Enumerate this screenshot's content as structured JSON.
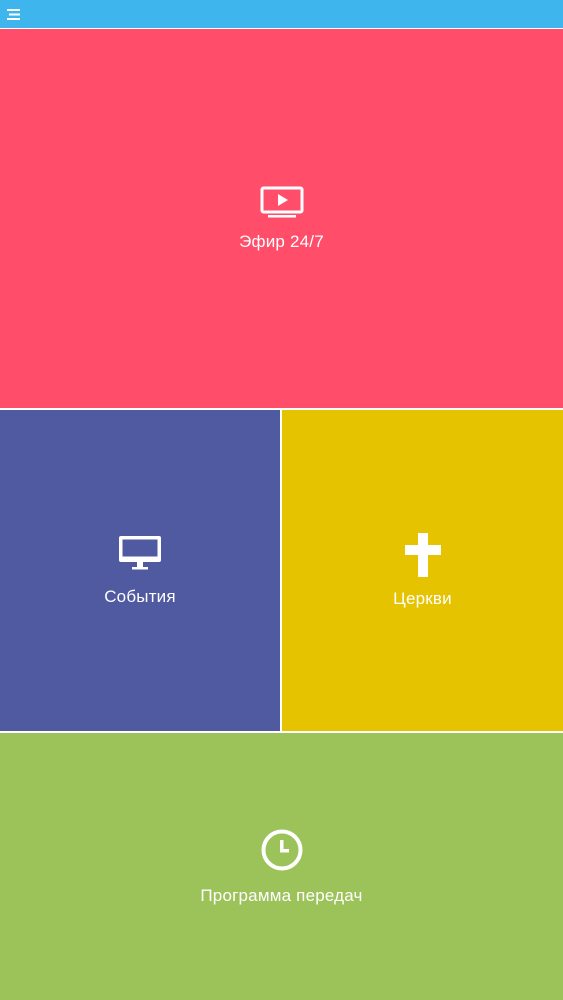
{
  "colors": {
    "top_bar": "#3fb5ee",
    "live_tile": "#ff4d6a",
    "events_tile": "#505aa0",
    "churches_tile": "#e5c300",
    "schedule_tile": "#9bc35a",
    "divider": "#ffffff",
    "text": "#ffffff"
  },
  "top_bar": {
    "menu_icon": "hamburger-menu-icon"
  },
  "tiles": [
    {
      "id": "live",
      "label": "Эфир 24/7",
      "icon": "tv-play-icon"
    },
    {
      "id": "events",
      "label": "События",
      "icon": "desktop-monitor-icon"
    },
    {
      "id": "churches",
      "label": "Церкви",
      "icon": "cross-icon"
    },
    {
      "id": "schedule",
      "label": "Программа передач",
      "icon": "clock-icon"
    }
  ]
}
